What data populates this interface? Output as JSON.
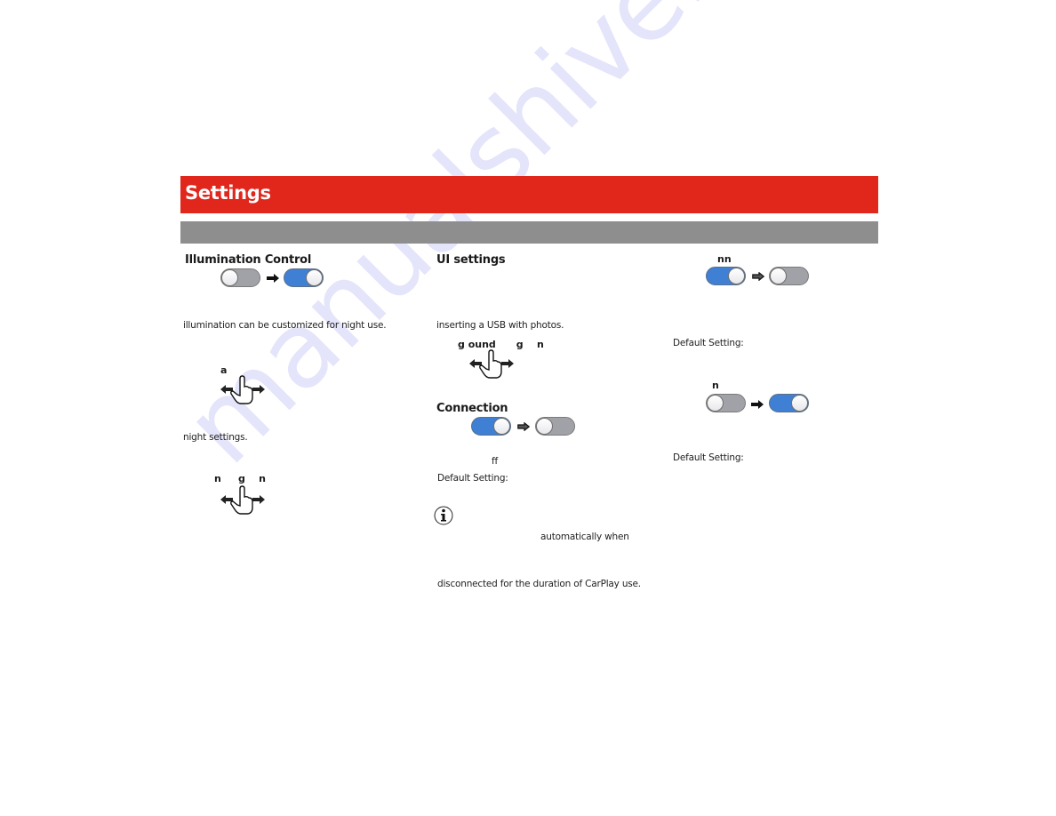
{
  "header": {
    "title": "Settings",
    "subtitle": ""
  },
  "colors": {
    "title_bar": "#e1261c",
    "sub_bar": "#8e8e8e",
    "toggle_on": "#3f7fd4",
    "toggle_off": "#a0a2a8",
    "watermark": "#c8c8f5"
  },
  "watermark": "manualshive.com",
  "column1": {
    "heading": "Illumination Control",
    "toggle_from": "off",
    "toggle_to": "on",
    "text1": "illumination can be customized for night use.",
    "gesture1_label": "a",
    "text2": "night settings.",
    "gesture2_label": "n     g    n"
  },
  "column2": {
    "heading": "UI settings",
    "text1": "inserting a USB with photos.",
    "gesture_label": "g ound      g    n",
    "connection": {
      "heading": "Connection",
      "toggle_from": "on",
      "toggle_to": "off",
      "state_text": "ff",
      "default_label": "Default Setting:"
    },
    "info_icon": "info-icon",
    "note_text1": "automatically when",
    "note_text2": "disconnected for the duration of CarPlay use."
  },
  "column3": {
    "item1": {
      "label": "nn",
      "toggle_from": "on",
      "toggle_to": "off",
      "default_label": "Default Setting:"
    },
    "item2": {
      "label": "n",
      "toggle_from": "off",
      "toggle_to": "on",
      "default_label": "Default Setting:"
    }
  }
}
